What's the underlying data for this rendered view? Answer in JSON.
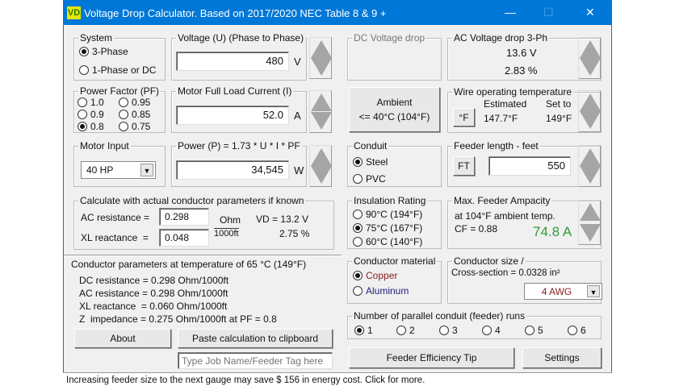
{
  "title": "Voltage Drop Calculator. Based on 2017/2020 NEC Table 8 & 9 +",
  "logo": "VD",
  "controls": {
    "minimize": "—",
    "maximize": "☐",
    "close": "✕"
  },
  "system": {
    "label": "System",
    "options": [
      "3-Phase",
      "1-Phase or DC"
    ],
    "selected": 0
  },
  "voltage": {
    "label": "Voltage (U) (Phase to Phase)",
    "value": "480",
    "unit": "V"
  },
  "pf": {
    "label": "Power Factor (PF)",
    "options": [
      "1.0",
      "0.95",
      "0.9",
      "0.85",
      "0.8",
      "0.75"
    ],
    "selected": "0.8"
  },
  "current": {
    "label": "Motor Full Load Current (I)",
    "value": "52.0",
    "unit": "A"
  },
  "motor_input": {
    "label": "Motor Input",
    "value": "40 HP"
  },
  "power": {
    "label": "Power (P) = 1.73 * U * I * PF",
    "value": "34,545",
    "unit": "W"
  },
  "actual": {
    "label": "Calculate with actual conductor parameters if known",
    "ac_label": "AC resistance =",
    "ac_value": "0.298",
    "xl_label": "XL reactance  =",
    "xl_value": "0.048",
    "unit_top": "Ohm",
    "unit_bottom": "1000ft",
    "vd": "VD = 13.2 V",
    "pct": "2.75 %"
  },
  "params": {
    "title": "Conductor parameters at temperature of 65 °C (149°F)",
    "lines": [
      "DC resistance = 0.298 Ohm/1000ft",
      "AC resistance = 0.298 Ohm/1000ft",
      "XL reactance  = 0.060 Ohm/1000ft",
      "Z  impedance = 0.275 Ohm/1000ft at PF = 0.8"
    ]
  },
  "buttons": {
    "about": "About",
    "paste": "Paste calculation to clipboard",
    "tip": "Feeder Efficiency Tip",
    "settings": "Settings"
  },
  "job_name": {
    "placeholder": "Type Job Name/Feeder Tag here"
  },
  "status": "Increasing feeder size to the next gauge may save $ 156 in energy cost. Click for more.",
  "dc": {
    "label": "DC Voltage drop"
  },
  "ac": {
    "label": "AC Voltage drop  3-Ph",
    "volts": "13.6 V",
    "pct": "2.83 %"
  },
  "ambient": {
    "line1": "Ambient",
    "line2": "<= 40°C (104°F)"
  },
  "wire_temp": {
    "label": "Wire operating temperature",
    "unit_btn": "°F",
    "est_label": "Estimated",
    "est": "147.7°F",
    "set_label": "Set to",
    "set": "149°F"
  },
  "conduit": {
    "label": "Conduit",
    "options": [
      "Steel",
      "PVC"
    ],
    "selected": 0
  },
  "feeder_length": {
    "label": "Feeder length - feet",
    "unit_btn": "FT",
    "value": "550"
  },
  "insulation": {
    "label": "Insulation Rating",
    "options": [
      "90°C (194°F)",
      "75°C (167°F)",
      "60°C (140°F)"
    ],
    "selected": 1
  },
  "ampacity": {
    "label": "Max. Feeder Ampacity",
    "line1": "at 104°F ambient temp.",
    "cf": "CF = 0.88",
    "value": "74.8 A",
    "color": "#2e9a3a"
  },
  "material": {
    "label": "Conductor material",
    "options": [
      "Copper",
      "Aluminum"
    ],
    "selected": 0
  },
  "size": {
    "label": "Conductor size /",
    "cross": "Cross-section = 0.0328 in²",
    "value": "4 AWG"
  },
  "runs": {
    "label": "Number of parallel conduit (feeder) runs",
    "options": [
      "1",
      "2",
      "3",
      "4",
      "5",
      "6"
    ],
    "selected": 0
  }
}
